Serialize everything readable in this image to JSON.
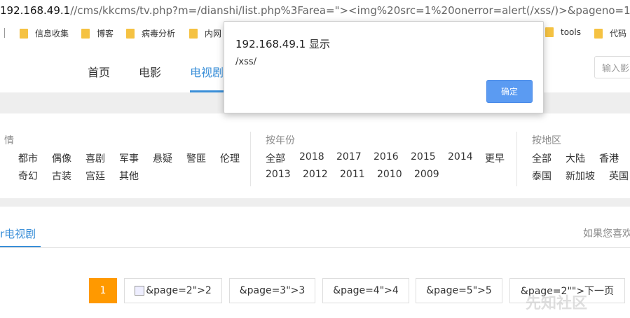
{
  "browser": {
    "url_host": "192.168.49.1",
    "url_path": "//cms/kkcms/tv.php?m=/dianshi/list.php%3Farea=\"><img%20src=1%20onerror=alert(/xss/)>&pageno=1",
    "bookmarks": [
      {
        "label": "信息收集",
        "icon": "folder-icon"
      },
      {
        "label": "博客",
        "icon": "folder-icon"
      },
      {
        "label": "病毒分析",
        "icon": "folder-icon"
      },
      {
        "label": "内网",
        "icon": "folder-icon"
      },
      {
        "label": "tools",
        "icon": "folder-icon"
      },
      {
        "label": "代码",
        "icon": "folder-icon"
      }
    ]
  },
  "site": {
    "nav": [
      "首页",
      "电影",
      "电视剧"
    ],
    "search_placeholder": "输入影",
    "filters": {
      "genre": {
        "title": "情",
        "items": [
          "都市",
          "偶像",
          "喜剧",
          "军事",
          "悬疑",
          "警匪",
          "伦理",
          "奇幻",
          "古装",
          "宫廷",
          "其他"
        ]
      },
      "year": {
        "title": "按年份",
        "items": [
          "全部",
          "2018",
          "2017",
          "2016",
          "2015",
          "2014",
          "更早",
          "2013",
          "2012",
          "2011",
          "2010",
          "2009"
        ]
      },
      "area": {
        "title": "按地区",
        "items": [
          "全部",
          "大陆",
          "香港",
          "泰国",
          "新加坡",
          "英国"
        ]
      }
    },
    "section_tab": "r电视剧",
    "section_right": "如果您喜欢",
    "pagination": [
      {
        "label": "1",
        "current": true
      },
      {
        "label": "&page=2\">2",
        "current": false,
        "broken_image": true
      },
      {
        "label": "&page=3\">3",
        "current": false
      },
      {
        "label": "&page=4\">4",
        "current": false
      },
      {
        "label": "&page=5\">5",
        "current": false
      },
      {
        "label": "&page=2\"\">下一页",
        "current": false
      }
    ],
    "watermark": "先知社区"
  },
  "alert": {
    "title": "192.168.49.1 显示",
    "message": "/xss/",
    "ok_label": "确定"
  },
  "colors": {
    "accent": "#3a8fd8",
    "page_current": "#ff9900",
    "alert_button": "#5b9bf2"
  }
}
